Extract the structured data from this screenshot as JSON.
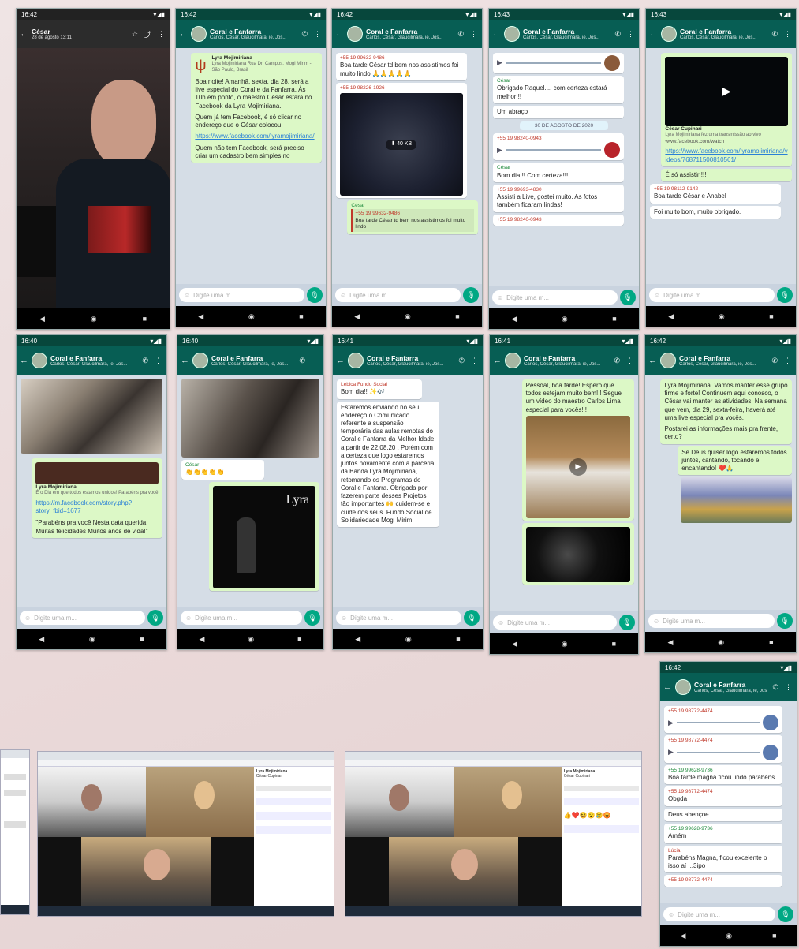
{
  "app": {
    "group_title": "Coral e Fanfarra",
    "group_members": "Carlos, César, Glaucilmara, ie, Jos...",
    "input_placeholder": "Digite uma m..."
  },
  "phones": [
    {
      "id": "p1",
      "time": "16:42",
      "title": "César",
      "subtitle": "28 de agosto 13:11"
    },
    {
      "id": "p2",
      "time": "16:42",
      "msgs": [
        {
          "sender": "Lyra Mojimiriana",
          "text": "Lyra Mojimiriana Rua Dr. Campos, Mogi Mirim - São Paulo, Brasil"
        },
        {
          "text": "Boa noite! Amanhã, sexta, dia 28, será a live especial do Coral e da Fanfarra. Às 10h em ponto, o maestro César estará no Facebook da Lyra Mojimiriana."
        },
        {
          "text": "Quem já tem Facebook, é só clicar no endereço que o César colocou."
        },
        {
          "link": "https://www.facebook.com/lyramojimiriana/"
        },
        {
          "text": "Quem não tem Facebook, será preciso criar um cadastro bem simples no"
        }
      ]
    },
    {
      "id": "p3",
      "time": "16:42",
      "msgs": [
        {
          "sender": "+55 19 99632-9486",
          "text": "Boa tarde César td bem nos assistimos foi muito lindo 🙏🙏🙏🙏🙏"
        },
        {
          "sender": "+55 19 98226-1926",
          "file": "40 KB"
        },
        {
          "sender": "César",
          "quote": "+55 19 99632-9486",
          "text": "Boa tarde César td bem nos assistimos foi muito lindo"
        }
      ]
    },
    {
      "id": "p4",
      "time": "16:43",
      "msgs": [
        {
          "sender": "César",
          "text": "Obrigado Raquel.... com certeza estará melhor!!!"
        },
        {
          "text": "Um abraço"
        },
        {
          "date": "30 DE AGOSTO DE 2020"
        },
        {
          "sender": "+55 19 98240-0943"
        },
        {
          "sender": "César",
          "text": "Bom dia!!! Com certeza!!!"
        },
        {
          "sender": "+55 19 99693-4830",
          "text": "Assisti a Live, gostei muito. As fotos também ficaram lindas!"
        },
        {
          "sender": "+55 19 98240-0943"
        }
      ]
    },
    {
      "id": "p5",
      "time": "16:43",
      "msgs": [
        {
          "sender": "César Cupinari",
          "text": "Lyra Mojimiriana fez uma transmissão ao vivo"
        },
        {
          "link": "www.facebook.com/watch"
        },
        {
          "link": "https://www.facebook.com/lyramojimiriana/videos/768711500810561/"
        },
        {
          "text": "É só assistir!!!!"
        },
        {
          "sender": "+55 19 98112-9142",
          "text": "Boa tarde César e Anabel"
        },
        {
          "text": "Foi muito bom, muito obrigado."
        }
      ]
    },
    {
      "id": "p6",
      "time": "16:40",
      "msgs": [
        {
          "sender": "Lyra Mojimiriana",
          "text": "É o Dia em que todos estamos unidos! Parabéns pra você"
        },
        {
          "link": "https://m.facebook.com/story.php?story_fbid=1677"
        },
        {
          "text": "\"Parabéns pra você Nesta data querida Muitas felicidades Muitos anos de vida!\""
        }
      ]
    },
    {
      "id": "p7",
      "time": "16:40",
      "msgs": [
        {
          "sender": "César",
          "text": "👏👏👏👏👏"
        },
        {
          "poster": "Lyra"
        }
      ]
    },
    {
      "id": "p8",
      "time": "16:41",
      "msgs": [
        {
          "sender": "Lebica Fundo Social",
          "text": "Bom dia!! ✨🎶"
        },
        {
          "text": "Estaremos enviando no seu endereço o Comunicado referente a suspensão temporária das aulas remotas do Coral e Fanfarra da Melhor Idade a partir de 22.08.20 . Porém com a certeza que logo estaremos juntos novamente com a parceria da Banda Lyra Mojimiriana, retomando os Programas do Coral e Fanfarra. Obrigada por fazerem parte desses Projetos tão importantes 🙌 cuidem-se e cuide dos seus. Fundo Social de Solidariedade Mogi Mirim"
        }
      ]
    },
    {
      "id": "p9",
      "time": "16:41",
      "msgs": [
        {
          "text": "Pessoal, boa tarde! Espero que todos estejam muito bem!!! Segue um vídeo do maestro Carlos Lima especial para vocês!!!"
        }
      ]
    },
    {
      "id": "p10",
      "time": "16:42",
      "msgs": [
        {
          "text": "Lyra Mojimiriana. Vamos manter esse grupo firme e forte! Continuem aqui conosco, o César vai manter as atividades! Na semana que vem, dia 29, sexta-feira, haverá até uma live especial pra vocês."
        },
        {
          "text": "Postarei as informações mais pra frente, certo?"
        },
        {
          "text": "Se Deus quiser logo estaremos todos juntos, cantando, tocando e encantando! ❤️🙏"
        }
      ]
    },
    {
      "id": "p11",
      "time": "16:42",
      "msgs": [
        {
          "sender": "+55 19 98772-4474"
        },
        {
          "sender": "+55 19 98772-4474"
        },
        {
          "sender": "+55 19 99628-9736",
          "text": "Boa tarde magna ficou lindo parabéns"
        },
        {
          "sender": "+55 19 98772-4474",
          "text": "Obgda"
        },
        {
          "text": "Deus abençoe"
        },
        {
          "sender": "+55 19 99628-9736",
          "text": "Amém"
        },
        {
          "sender": "Lúcia",
          "text": "Parabéns Magna, ficou excelente o isso aí ...3ipo"
        },
        {
          "sender": "+55 19 98772-4474"
        }
      ]
    }
  ],
  "screenshots": {
    "sidebar_title": "Lyra Mojimiriana",
    "sidebar_sub": "César Cupinari"
  }
}
